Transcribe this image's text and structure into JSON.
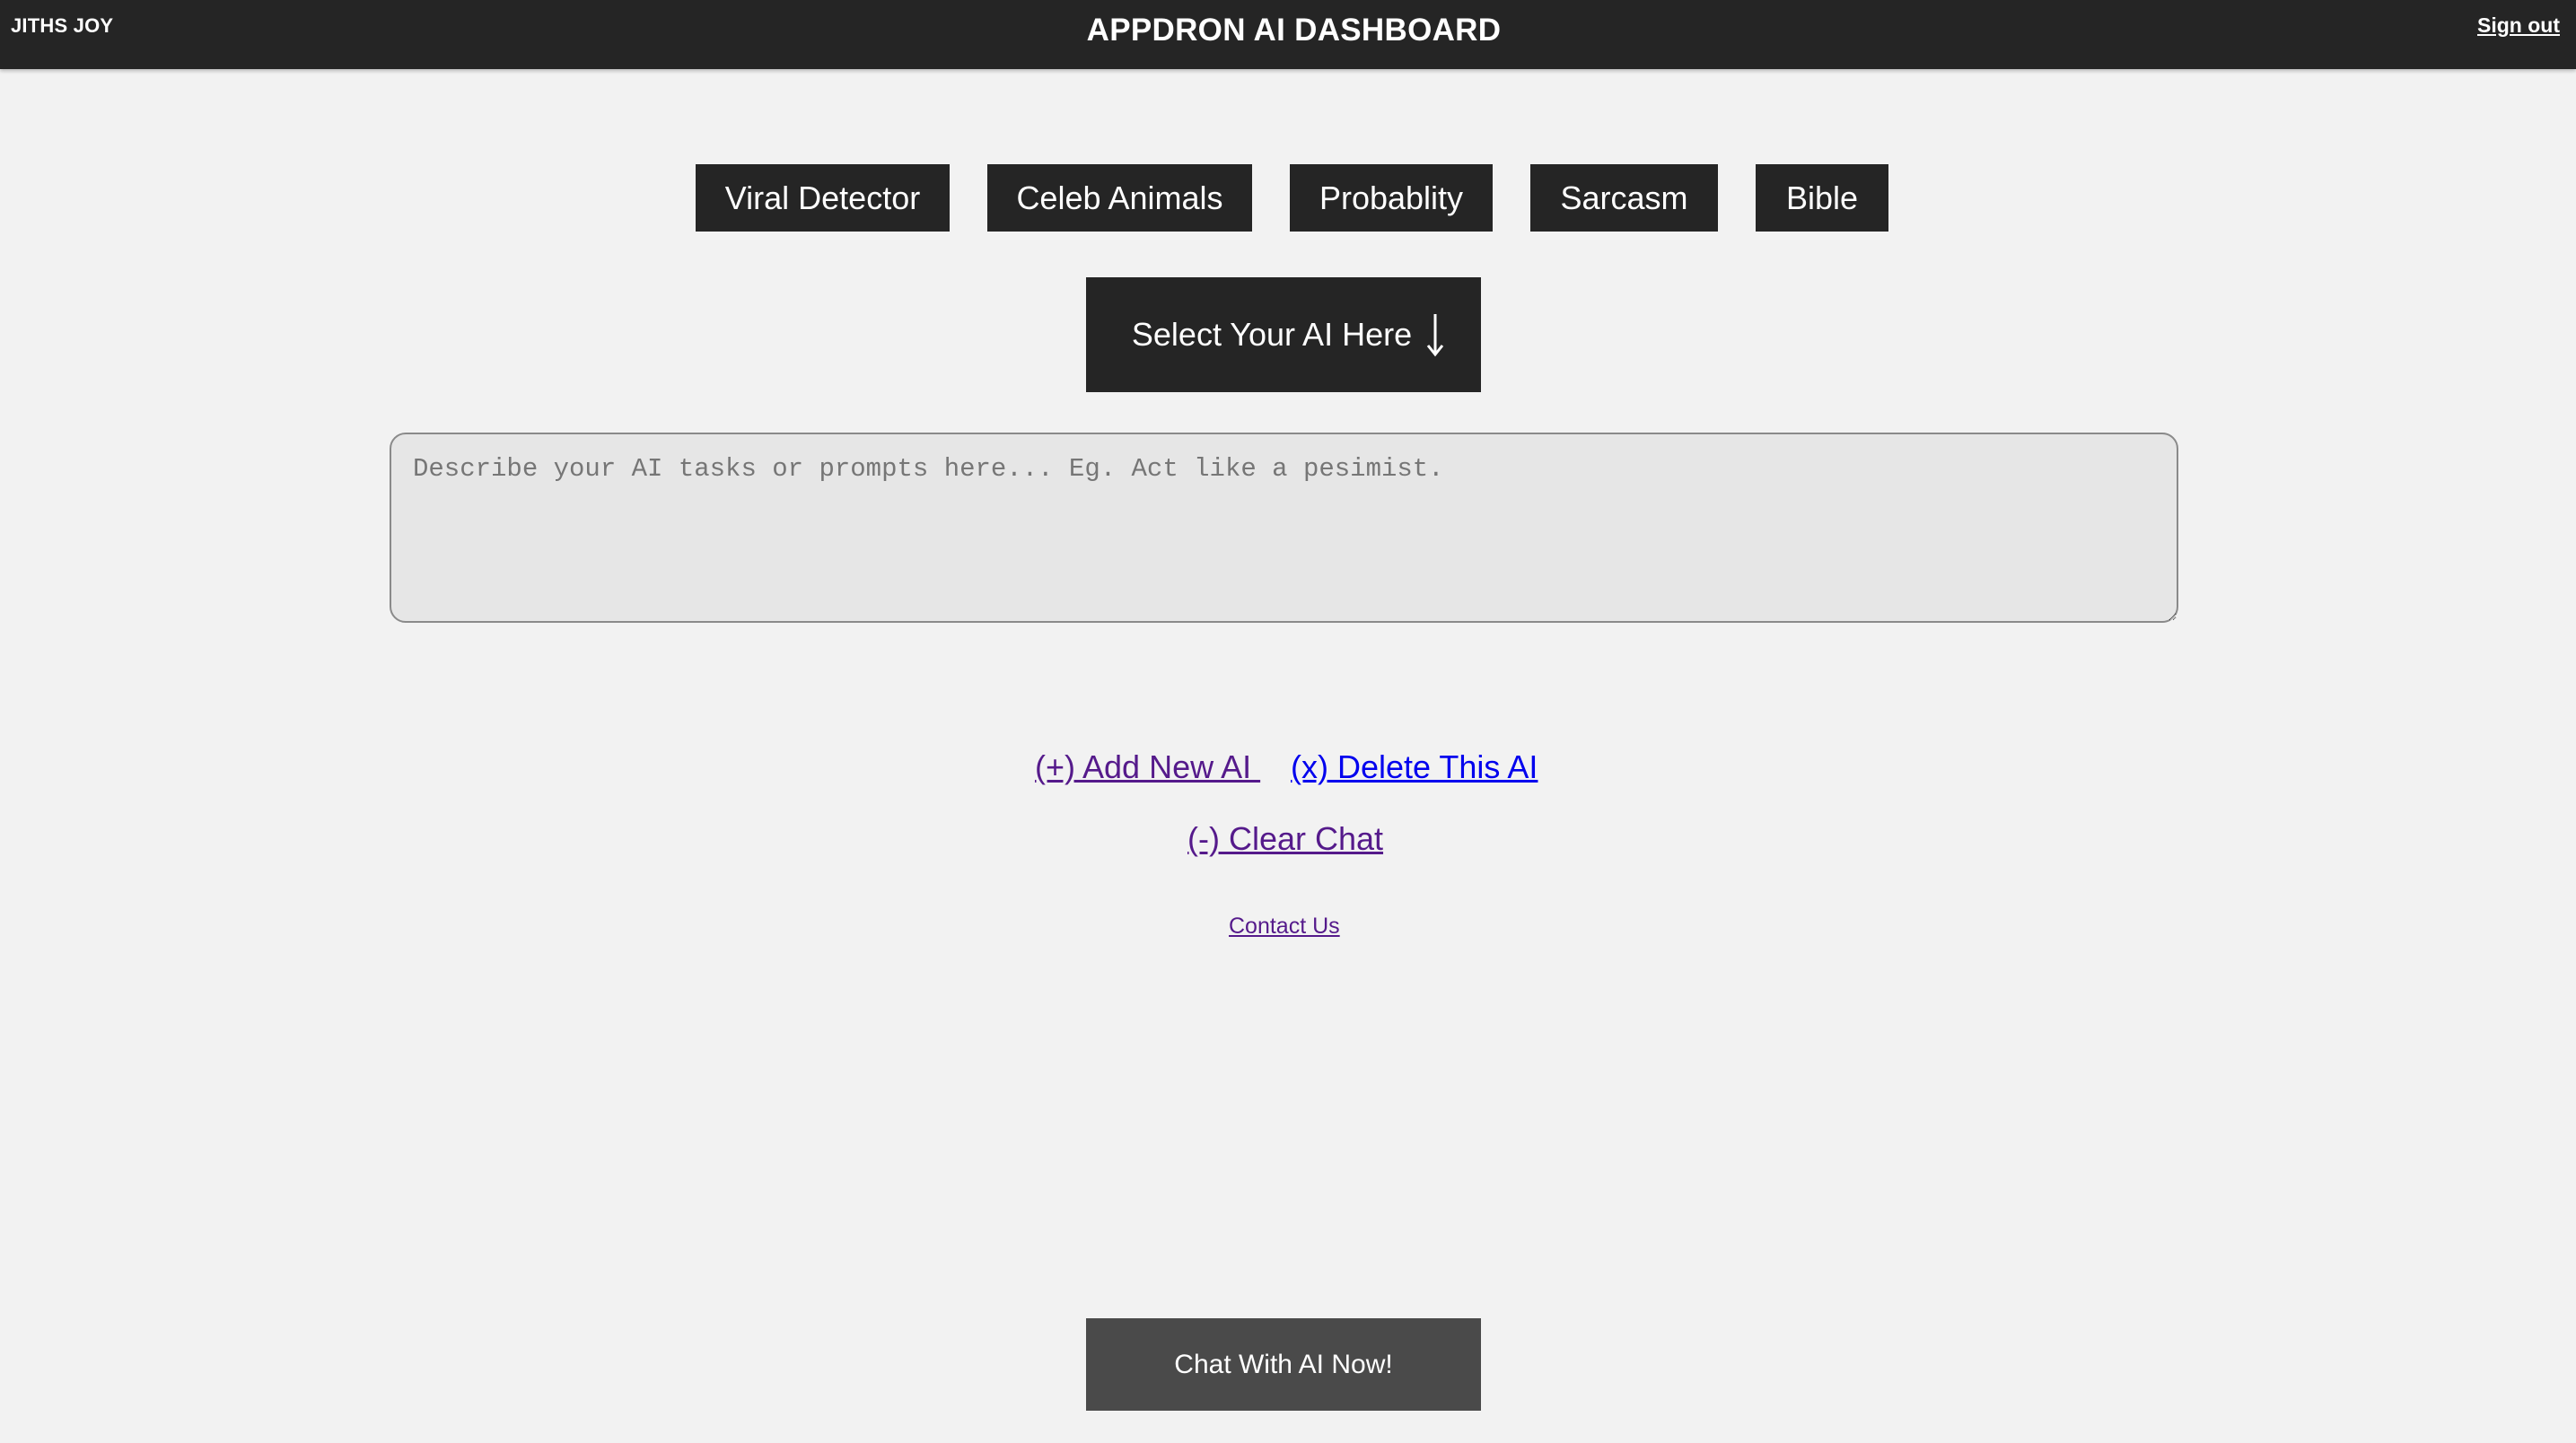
{
  "header": {
    "user_name": "JITHS JOY",
    "title": "APPDRON AI DASHBOARD",
    "sign_out_label": "Sign out"
  },
  "ai_tabs": [
    {
      "label": "Viral Detector"
    },
    {
      "label": "Celeb Animals"
    },
    {
      "label": "Probablity"
    },
    {
      "label": "Sarcasm"
    },
    {
      "label": "Bible"
    }
  ],
  "selector": {
    "label": "Select Your AI Here",
    "icon": "arrow-down-icon"
  },
  "prompt": {
    "value": "",
    "placeholder": "Describe your AI tasks or prompts here... Eg. Act like a pesimist."
  },
  "actions": {
    "add_label": "(+) Add New AI ",
    "delete_label": "(x) Delete This AI",
    "clear_label": "(-) Clear Chat",
    "contact_label": "Contact Us"
  },
  "chat": {
    "button_label": "Chat With AI Now!"
  },
  "colors": {
    "header_bg": "#252525",
    "page_bg": "#f2f2f2",
    "button_bg": "#252525",
    "chat_button_bg": "#4a4a4a",
    "visited_link": "#551a8b",
    "link": "#0000ee"
  }
}
